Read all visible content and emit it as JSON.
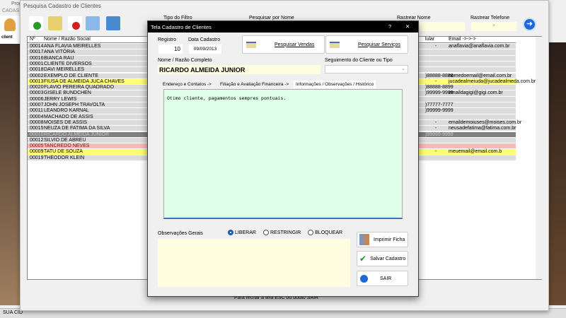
{
  "app": {
    "title": "Prog",
    "menu": "CADAS",
    "toolbar_label": "client",
    "status": "SUA CID"
  },
  "search": {
    "title": "Pesquisa Cadastro de Clientes",
    "filter_type_label": "Tipo do Filtro",
    "search_name_label": "Pesquisar por Nome",
    "track_name_label": "Rastrear Nome",
    "track_phone_label": "Rastrear Telefone",
    "track_phone_value": "-",
    "footer_hint": "Para fechar a tela ESC ou botão SAIR",
    "columns": {
      "num": "Nº",
      "name": "Nome / Razão Social",
      "cell": "lular",
      "email": "Email ->->->"
    },
    "rows": [
      {
        "num": "00014",
        "name": "ANA FLAVIA MEIRELLES",
        "cell": "-",
        "email": "anaflavia@anaflavia.com.br",
        "color": "#dcdcdc"
      },
      {
        "num": "00017",
        "name": "ANA VITÓRIA",
        "cell": "",
        "email": "",
        "color": "#dcdcdc"
      },
      {
        "num": "00016",
        "name": "BIANCA RAU",
        "cell": "",
        "email": "",
        "color": "#dcdcdc"
      },
      {
        "num": "00001",
        "name": "CLIENTE DIVERSOS",
        "cell": "",
        "email": "",
        "color": "#dcdcdc"
      },
      {
        "num": "00018",
        "name": "DAVI MEIRELLES",
        "cell": "",
        "email": "",
        "color": "#dcdcdc"
      },
      {
        "num": "00002",
        "name": "EXEMPLO DE CLIENTE",
        "cell": ")88888-8888",
        "email": "nomedoemail@email.com.br",
        "color": "#dcdcdc"
      },
      {
        "num": "00013",
        "name": "FIUSA DE ALMEIDA JUCA CHAVES",
        "cell": "-",
        "email": "jucadealmeiuda@jucadealmeda.com.br",
        "color": "#ffff70"
      },
      {
        "num": "00020",
        "name": "FLAVIO PEREIRA QUADRADO",
        "cell": ")88888-8899",
        "email": "",
        "color": "#dcdcdc"
      },
      {
        "num": "00003",
        "name": "GISELE BUNDCHEN",
        "cell": ")99999-9999",
        "email": "emaildagigi@gigi.com.br",
        "color": "#dcdcdc"
      },
      {
        "num": "00006",
        "name": "JERRY LEWIS",
        "cell": "",
        "email": "",
        "color": "#dcdcdc"
      },
      {
        "num": "00007",
        "name": "JOHN JOSEPH TRAVOLTA",
        "cell": ")77777-7777",
        "email": "",
        "color": "#dcdcdc"
      },
      {
        "num": "00011",
        "name": "LEANDRO KARNAL",
        "cell": ")99999-9999",
        "email": "",
        "color": "#dcdcdc"
      },
      {
        "num": "00004",
        "name": "MACHADO DE ASSIS",
        "cell": "",
        "email": "",
        "color": "#dcdcdc"
      },
      {
        "num": "00008",
        "name": "MOISES DE ASSIS",
        "cell": "-",
        "email": "emaildemoiuses@moises.com.br",
        "color": "#dcdcdc"
      },
      {
        "num": "00015",
        "name": "NEUZA DE FATIMA DA SILVA",
        "cell": "-",
        "email": "neusadefatima@fatima.com.br",
        "color": "#dcdcdc"
      },
      {
        "num": "00010",
        "name": "RICARDO ALMEIDA JUNIOR",
        "cell": ")99999-9999",
        "email": "",
        "color": "#808080"
      },
      {
        "num": "00012",
        "name": "SILVIO DE ABREU",
        "cell": "",
        "email": "",
        "color": "#dcdcdc"
      },
      {
        "num": "00005",
        "name": "TANCREDO NEVES",
        "cell": "",
        "email": "",
        "color": "#ffb8b8"
      },
      {
        "num": "00009",
        "name": "TATU DE SOUZA",
        "cell": "-",
        "email": "meuemail@email.com.b",
        "color": "#ffff70"
      },
      {
        "num": "00019",
        "name": "THEODOR KLEIN",
        "cell": "",
        "email": "",
        "color": "#dcdcdc"
      }
    ]
  },
  "dialog": {
    "title": "Tela Cadastro de Clientes",
    "help": "?",
    "close": "✕",
    "registro_label": "Registro",
    "registro": "10",
    "data_label": "Data Cadastro",
    "data": "09/09/2013",
    "btn_vendas": "Pesquisar Vendas",
    "btn_servicos": "Pesquisar Serviços",
    "nome_label": "Nome / Razão Completo",
    "nome": "RICARDO ALMEIDA JUNIOR",
    "seg_label": "Seguimento do Cliente ou Tipo",
    "seg_value": "",
    "tabs": [
      "Endereço e Contatos ->",
      "Filiação e Avaliação Financeira ->",
      "Informações / Observações / Histórico"
    ],
    "memo": "Otimo cliente, pagamentos sempres pontuais.",
    "obs_label": "Observações Gerais",
    "obs": "",
    "radios": [
      {
        "label": "LIBERAR",
        "checked": true
      },
      {
        "label": "RESTRINGIR",
        "checked": false
      },
      {
        "label": "BLOQUEAR",
        "checked": false
      }
    ],
    "btn_imprimir": "Imprimir Ficha",
    "btn_salvar": "Salvar Cadastro",
    "btn_sair": "SAIR"
  },
  "colors": {
    "memo_bg": "#dfffe8",
    "input_bg": "#fffde0",
    "selected_row": "#808080",
    "highlight_yellow": "#ffff70",
    "highlight_red": "#ffb8b8"
  }
}
